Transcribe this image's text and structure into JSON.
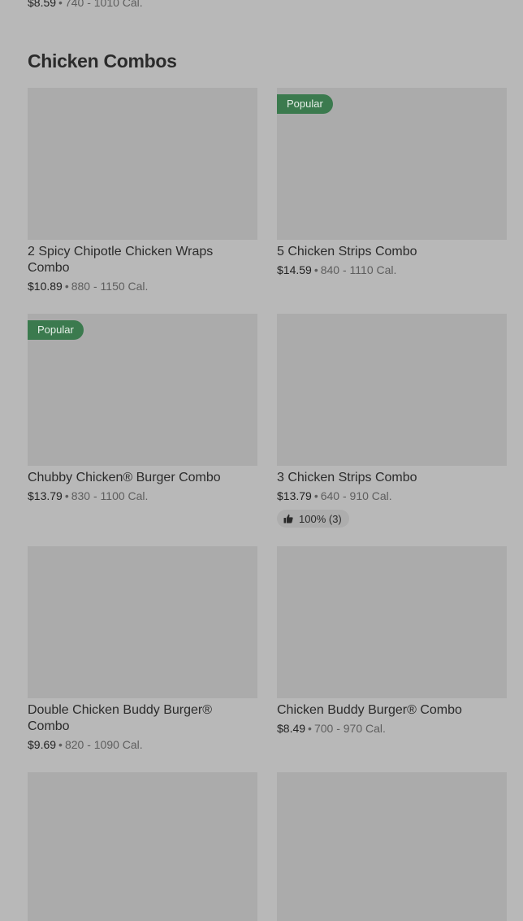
{
  "previous_item": {
    "price": "$8.59",
    "calories": "740 - 1010 Cal."
  },
  "section": {
    "title": "Chicken Combos"
  },
  "items": [
    {
      "name": "2 Spicy Chipotle Chicken Wraps Combo",
      "price": "$10.89",
      "calories": "880 - 1150 Cal."
    },
    {
      "badge": "Popular",
      "name": "5 Chicken Strips Combo",
      "price": "$14.59",
      "calories": "840 - 1110 Cal."
    },
    {
      "badge": "Popular",
      "name": "Chubby Chicken® Burger Combo",
      "price": "$13.79",
      "calories": "830 - 1100 Cal."
    },
    {
      "name": "3 Chicken Strips Combo",
      "price": "$13.79",
      "calories": "640 - 910 Cal.",
      "rating": "100% (3)",
      "rating_icon": "thumbs-up-icon"
    },
    {
      "name": "Double Chicken Buddy Burger® Combo",
      "price": "$9.69",
      "calories": "820 - 1090 Cal."
    },
    {
      "name": "Chicken Buddy Burger® Combo",
      "price": "$8.49",
      "calories": "700 - 970 Cal."
    },
    {},
    {}
  ],
  "separator": "•",
  "colors": {
    "background": "#b8b8b8",
    "thumbnail": "#ababab",
    "badge": "#3b7a4e",
    "text": "#2b2b2b",
    "muted_text": "#5e5e5e"
  }
}
